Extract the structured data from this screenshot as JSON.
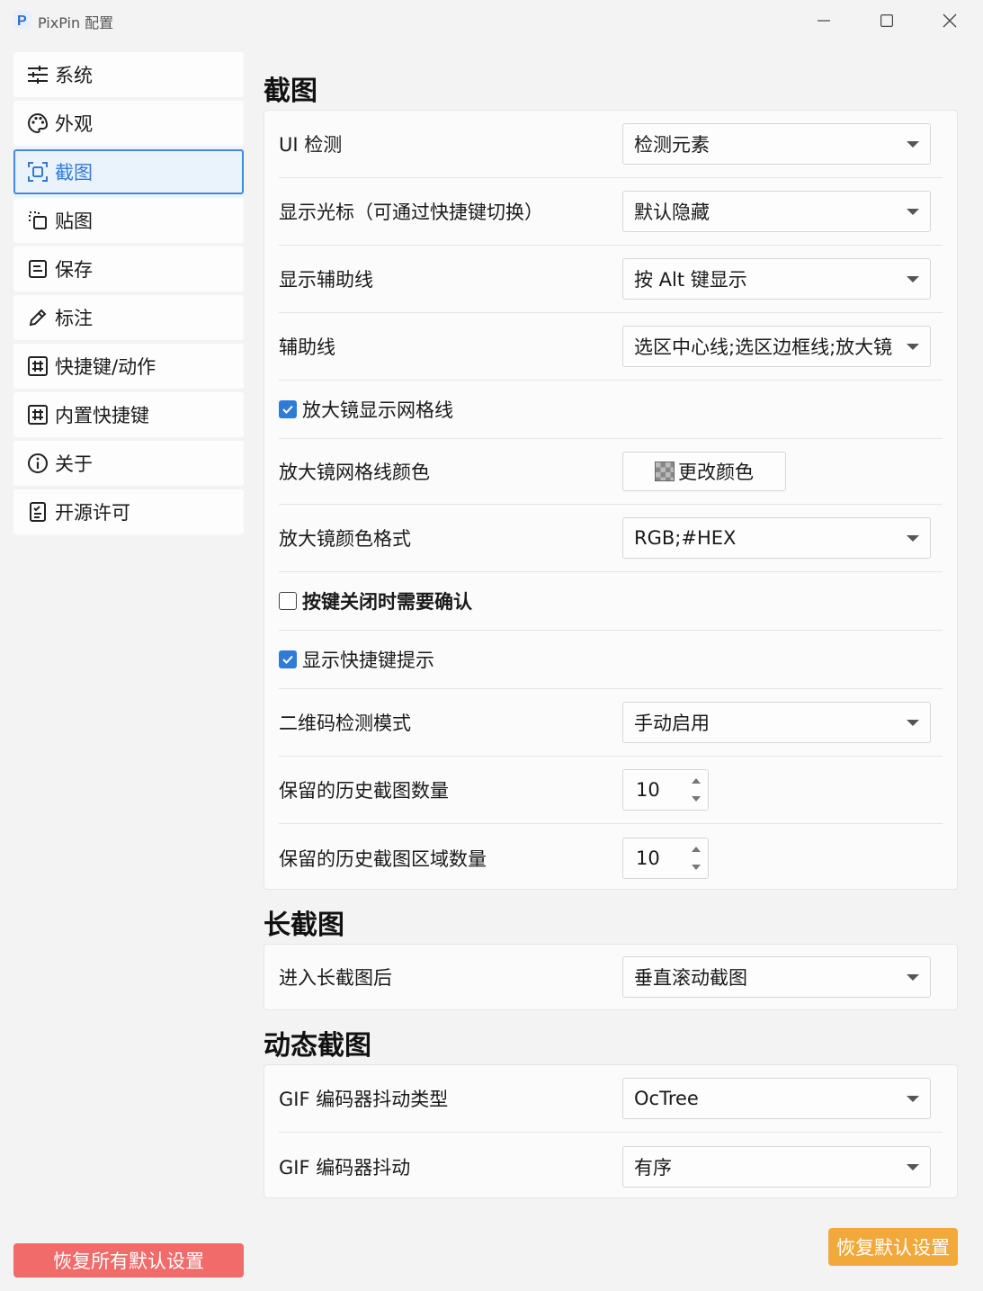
{
  "window": {
    "title": "PixPin 配置",
    "logo_letter": "P"
  },
  "sidebar": {
    "items": [
      {
        "label": "系统",
        "icon": "sliders-icon"
      },
      {
        "label": "外观",
        "icon": "palette-icon"
      },
      {
        "label": "截图",
        "icon": "screenshot-icon",
        "active": true
      },
      {
        "label": "贴图",
        "icon": "pin-icon"
      },
      {
        "label": "保存",
        "icon": "save-icon"
      },
      {
        "label": "标注",
        "icon": "pencil-icon"
      },
      {
        "label": "快捷键/动作",
        "icon": "hash-icon"
      },
      {
        "label": "内置快捷键",
        "icon": "hash-icon"
      },
      {
        "label": "关于",
        "icon": "info-icon"
      },
      {
        "label": "开源许可",
        "icon": "license-icon"
      }
    ],
    "reset_all_label": "恢复所有默认设置"
  },
  "screenshot": {
    "title": "截图",
    "ui_detect_label": "UI 检测",
    "ui_detect_value": "检测元素",
    "show_cursor_label": "显示光标（可通过快捷键切换）",
    "show_cursor_value": "默认隐藏",
    "show_guides_label": "显示辅助线",
    "show_guides_value": "按 Alt 键显示",
    "guides_label": "辅助线",
    "guides_value": "选区中心线;选区边框线;放大镜",
    "magnifier_grid_label": "放大镜显示网格线",
    "magnifier_grid_checked": true,
    "grid_color_label": "放大镜网格线颜色",
    "grid_color_button": "更改颜色",
    "color_format_label": "放大镜颜色格式",
    "color_format_value": "RGB;#HEX",
    "confirm_close_label": "按键关闭时需要确认",
    "confirm_close_checked": false,
    "show_hints_label": "显示快捷键提示",
    "show_hints_checked": true,
    "qr_mode_label": "二维码检测模式",
    "qr_mode_value": "手动启用",
    "history_count_label": "保留的历史截图数量",
    "history_count_value": "10",
    "history_region_label": "保留的历史截图区域数量",
    "history_region_value": "10"
  },
  "long_screenshot": {
    "title": "长截图",
    "after_enter_label": "进入长截图后",
    "after_enter_value": "垂直滚动截图"
  },
  "dynamic_screenshot": {
    "title": "动态截图",
    "dither_type_label": "GIF 编码器抖动类型",
    "dither_type_value": "OcTree",
    "dither_label": "GIF 编码器抖动",
    "dither_value": "有序"
  },
  "footer": {
    "reset_default_label": "恢复默认设置"
  },
  "colors": {
    "accent": "#2f7bd6",
    "danger": "#f16b6b",
    "warning": "#f2a93b"
  }
}
